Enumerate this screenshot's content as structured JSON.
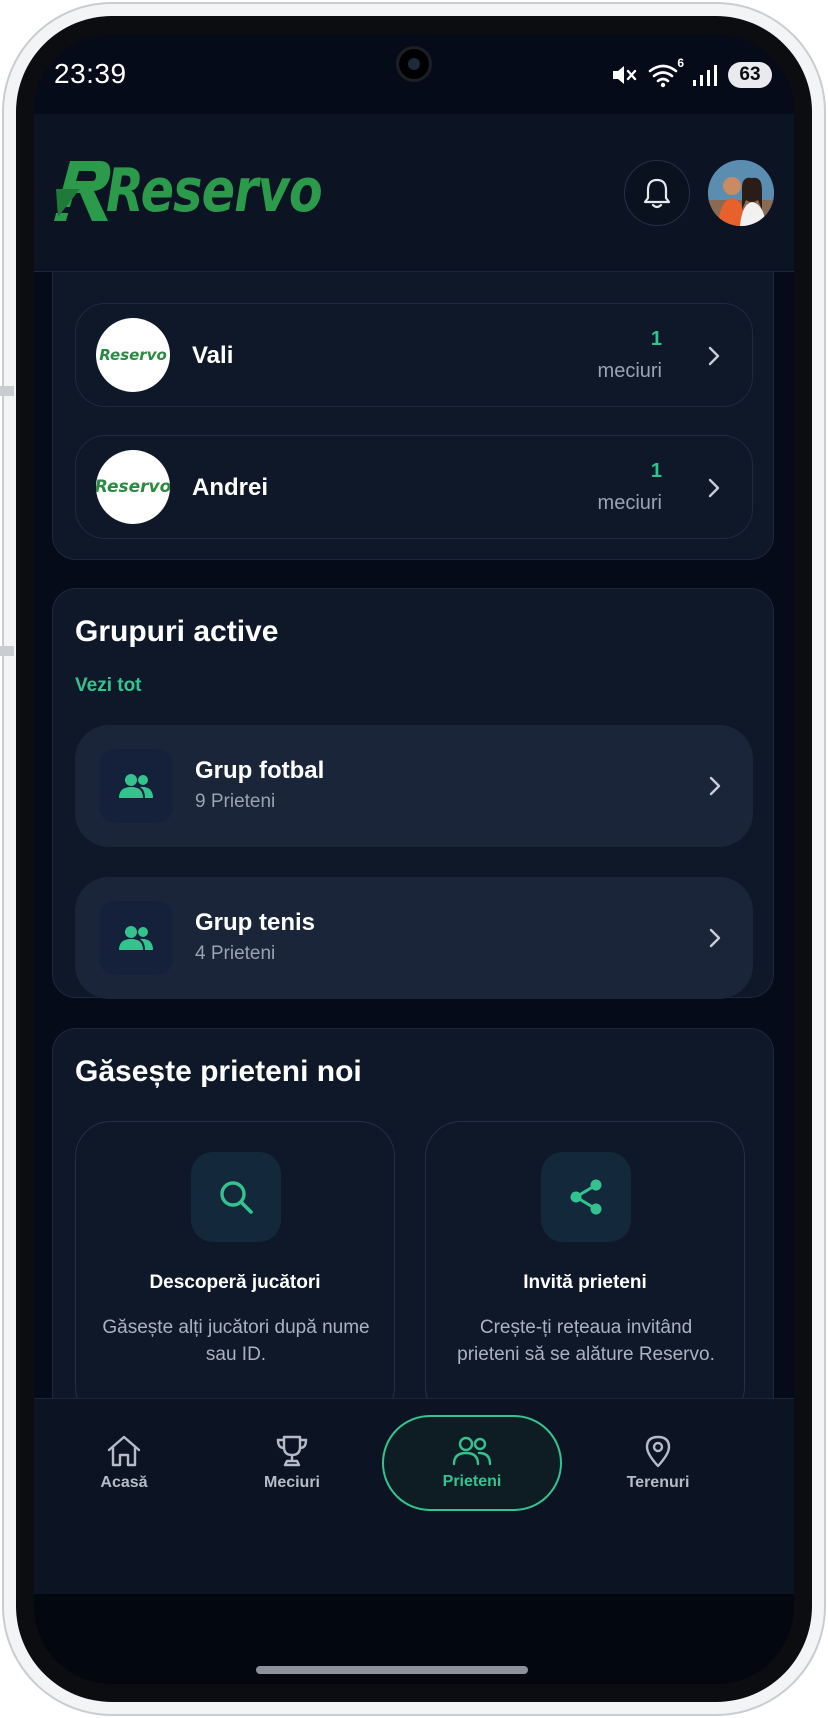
{
  "status_bar": {
    "time": "23:39",
    "wifi_badge": "6",
    "battery": "63"
  },
  "header": {
    "logo_text": "Reservo",
    "bell_icon": "bell-icon",
    "avatar": "user-avatar"
  },
  "friends": [
    {
      "name": "Vali",
      "matches": "1",
      "matches_label": "meciuri",
      "logo_text": "Reservo"
    },
    {
      "name": "Andrei",
      "matches": "1",
      "matches_label": "meciuri",
      "logo_text": "Reservo"
    }
  ],
  "groups_section": {
    "title": "Grupuri active",
    "see_all": "Vezi tot",
    "groups": [
      {
        "name": "Grup fotbal",
        "members": "9 Prieteni"
      },
      {
        "name": "Grup tenis",
        "members": "4 Prieteni"
      }
    ]
  },
  "find_section": {
    "title": "Găsește prieteni noi",
    "tiles": [
      {
        "icon": "search-icon",
        "title": "Descoperă jucători",
        "description": "Găsește alți jucători după nume sau ID."
      },
      {
        "icon": "share-icon",
        "title": "Invită prieteni",
        "description": "Crește-ți rețeaua invitând prieteni să se alăture Reservo."
      }
    ]
  },
  "bottom_nav": {
    "items": [
      {
        "label": "Acasă",
        "icon": "home-icon",
        "active": false
      },
      {
        "label": "Meciuri",
        "icon": "trophy-icon",
        "active": false
      },
      {
        "label": "Prieteni",
        "icon": "users-icon",
        "active": true
      },
      {
        "label": "Terenuri",
        "icon": "map-pin-icon",
        "active": false
      }
    ]
  },
  "colors": {
    "accent": "#34c38f",
    "brand": "#2b9a4a",
    "background": "#050b18",
    "card": "#0f1828"
  }
}
